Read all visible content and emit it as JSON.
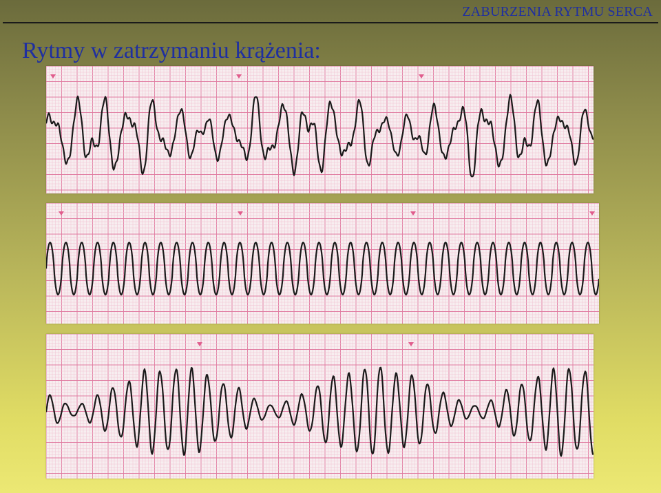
{
  "header": {
    "title": "ZABURZENIA RYTMU SERCA"
  },
  "slide": {
    "title": "Rytmy w zatrzymaniu krążenia:"
  },
  "strips": [
    {
      "name": "ecg-strip-1"
    },
    {
      "name": "ecg-strip-2"
    },
    {
      "name": "ecg-strip-3"
    }
  ],
  "colors": {
    "title": "#1f2fa0",
    "grid_minor": "#f2c2d2",
    "grid_major": "#e07aa0",
    "trace": "#1a1a1a",
    "marker": "#e05c8c"
  }
}
